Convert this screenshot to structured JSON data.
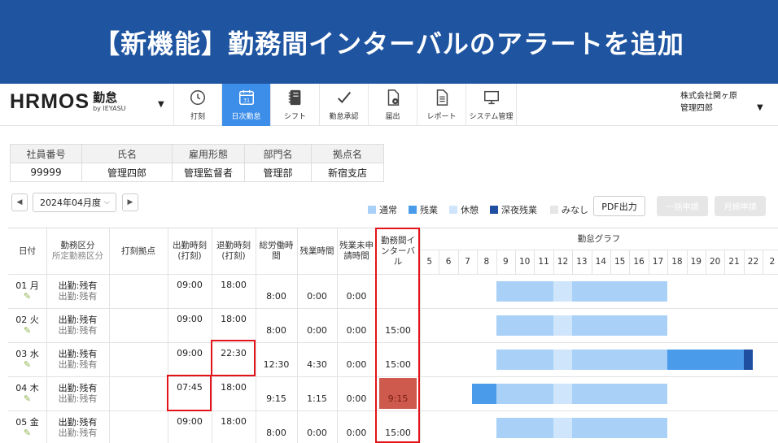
{
  "banner": {
    "title": "【新機能】勤務間インターバルのアラートを追加"
  },
  "logo": {
    "main": "HRMOS",
    "app": "勤怠",
    "by": "by IEYASU",
    "caret": "▼"
  },
  "nav": [
    {
      "label": "打刻",
      "icon": "clock-icon",
      "active": false
    },
    {
      "label": "日次勤怠",
      "icon": "calendar-icon",
      "active": true
    },
    {
      "label": "シフト",
      "icon": "notebook-icon",
      "active": false
    },
    {
      "label": "勤怠承認",
      "icon": "check-icon",
      "active": false
    },
    {
      "label": "届出",
      "icon": "document-icon",
      "active": false
    },
    {
      "label": "レポート",
      "icon": "report-icon",
      "active": false
    },
    {
      "label": "システム管理",
      "icon": "monitor-icon",
      "active": false
    }
  ],
  "company": {
    "name": "株式会社関ヶ原",
    "user": "管理四郎",
    "caret": "▼"
  },
  "employee": {
    "headers": [
      "社員番号",
      "氏名",
      "雇用形態",
      "部門名",
      "拠点名"
    ],
    "values": [
      "99999",
      "管理四郎",
      "管理監督者",
      "管理部",
      "新宿支店"
    ]
  },
  "month": {
    "prev": "◀",
    "value": "2024年04月度",
    "chevron": "⌵",
    "next": "▶"
  },
  "legend": [
    {
      "label": "通常",
      "color": "#a9d1f7"
    },
    {
      "label": "残業",
      "color": "#4a9bea"
    },
    {
      "label": "休憩",
      "color": "#cfe5fb"
    },
    {
      "label": "深夜残業",
      "color": "#1f4fa0"
    },
    {
      "label": "みなし",
      "color": "#e6e6e6"
    }
  ],
  "buttons": {
    "pdf": "PDF出力",
    "bulk": "一括申請",
    "monthly": "月締申請"
  },
  "table": {
    "headers": {
      "date": "日付",
      "work_type": "勤務区分",
      "work_type_sub": "所定勤務区分",
      "stamp_place": "打刻拠点",
      "clock_in": "出勤時刻",
      "clock_in_sub": "(打刻)",
      "clock_out": "退勤時刻",
      "clock_out_sub": "(打刻)",
      "total_1": "総労働時",
      "total_2": "間",
      "overtime": "残業時間",
      "unapplied_1": "残業未申",
      "unapplied_2": "請時間",
      "interval_1": "勤務間イ",
      "interval_2": "ンターバ",
      "interval_3": "ル",
      "graph": "勤怠グラフ"
    },
    "hours": [
      "5",
      "6",
      "7",
      "8",
      "9",
      "10",
      "11",
      "12",
      "13",
      "14",
      "15",
      "16",
      "17",
      "18",
      "19",
      "20",
      "21",
      "22",
      "2"
    ],
    "rows": [
      {
        "date": "01 月",
        "type": "出勤:残有",
        "type_sub": "出勤:残有",
        "clock_in": "09:00",
        "clock_out": "18:00",
        "total": "8:00",
        "overtime": "0:00",
        "unapplied": "0:00",
        "interval": ""
      },
      {
        "date": "02 火",
        "type": "出勤:残有",
        "type_sub": "出勤:残有",
        "clock_in": "09:00",
        "clock_out": "18:00",
        "total": "8:00",
        "overtime": "0:00",
        "unapplied": "0:00",
        "interval": "15:00"
      },
      {
        "date": "03 水",
        "type": "出勤:残有",
        "type_sub": "出勤:残有",
        "clock_in": "09:00",
        "clock_out": "22:30",
        "total": "12:30",
        "overtime": "4:30",
        "unapplied": "0:00",
        "interval": "15:00"
      },
      {
        "date": "04 木",
        "type": "出勤:残有",
        "type_sub": "出勤:残有",
        "clock_in": "07:45",
        "clock_out": "18:00",
        "total": "9:15",
        "overtime": "1:15",
        "unapplied": "0:00",
        "interval": "9:15"
      },
      {
        "date": "05 金",
        "type": "出勤:残有",
        "type_sub": "出勤:残有",
        "clock_in": "09:00",
        "clock_out": "18:00",
        "total": "8:00",
        "overtime": "0:00",
        "unapplied": "0:00",
        "interval": "15:00"
      }
    ],
    "graph_segments": [
      [
        {
          "start": 9,
          "end": 12,
          "kind": "normal"
        },
        {
          "start": 12,
          "end": 13,
          "kind": "break"
        },
        {
          "start": 13,
          "end": 18,
          "kind": "normal"
        }
      ],
      [
        {
          "start": 9,
          "end": 12,
          "kind": "normal"
        },
        {
          "start": 12,
          "end": 13,
          "kind": "break"
        },
        {
          "start": 13,
          "end": 18,
          "kind": "normal"
        }
      ],
      [
        {
          "start": 9,
          "end": 12,
          "kind": "normal"
        },
        {
          "start": 12,
          "end": 13,
          "kind": "break"
        },
        {
          "start": 13,
          "end": 18,
          "kind": "normal"
        },
        {
          "start": 18,
          "end": 22,
          "kind": "overtime"
        },
        {
          "start": 22,
          "end": 22.5,
          "kind": "night"
        }
      ],
      [
        {
          "start": 7.75,
          "end": 9,
          "kind": "overtime"
        },
        {
          "start": 9,
          "end": 12,
          "kind": "normal"
        },
        {
          "start": 12,
          "end": 13,
          "kind": "break"
        },
        {
          "start": 13,
          "end": 18,
          "kind": "normal"
        }
      ],
      [
        {
          "start": 9,
          "end": 12,
          "kind": "normal"
        },
        {
          "start": 12,
          "end": 13,
          "kind": "break"
        },
        {
          "start": 13,
          "end": 18,
          "kind": "normal"
        }
      ]
    ],
    "alert": {
      "row": 3,
      "color": "#cd5a4d",
      "text_color": "#7a1d14"
    },
    "highlight_color": "#e2141a",
    "pencil_icon": "pencil-icon"
  }
}
